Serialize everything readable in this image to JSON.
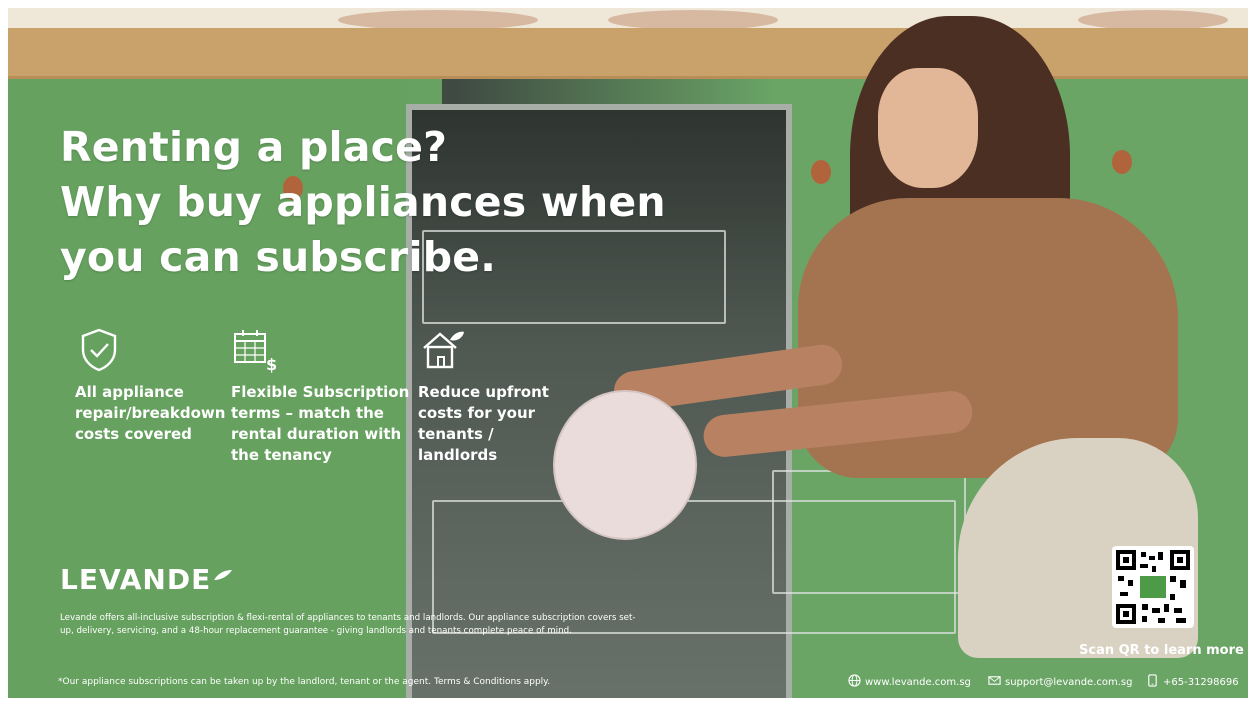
{
  "headline": {
    "line1": "Renting a place?",
    "line2": "Why buy appliances when",
    "line3": "you can subscribe."
  },
  "features": [
    {
      "icon": "shield-check-icon",
      "text": [
        "All appliance",
        "repair/breakdown",
        "costs covered"
      ]
    },
    {
      "icon": "calendar-dollar-icon",
      "text": [
        "Flexible Subscription",
        "terms – match the",
        "rental duration with",
        "the tenancy"
      ]
    },
    {
      "icon": "home-leaf-icon",
      "text": [
        "Reduce upfront",
        "costs for your",
        "tenants /",
        "landlords"
      ]
    }
  ],
  "brand": {
    "name": "LEVANDE"
  },
  "fine_print": "Levande offers all-inclusive subscription & flexi-rental of appliances to tenants and landlords. Our appliance subscription covers set-up, delivery, servicing, and a 48-hour replacement guarantee - giving landlords and tenants complete peace of mind.",
  "footnote": "*Our appliance subscriptions can be taken up by the landlord, tenant or the agent. Terms & Conditions apply.",
  "qr": {
    "caption": "Scan QR to learn more"
  },
  "contacts": {
    "website": "www.levande.com.sg",
    "email": "support@levande.com.sg",
    "phone": "+65-31298696"
  },
  "colors": {
    "cabinet_green": "#6aa566",
    "text_white": "#ffffff",
    "brand_accent": "#ffffff"
  }
}
